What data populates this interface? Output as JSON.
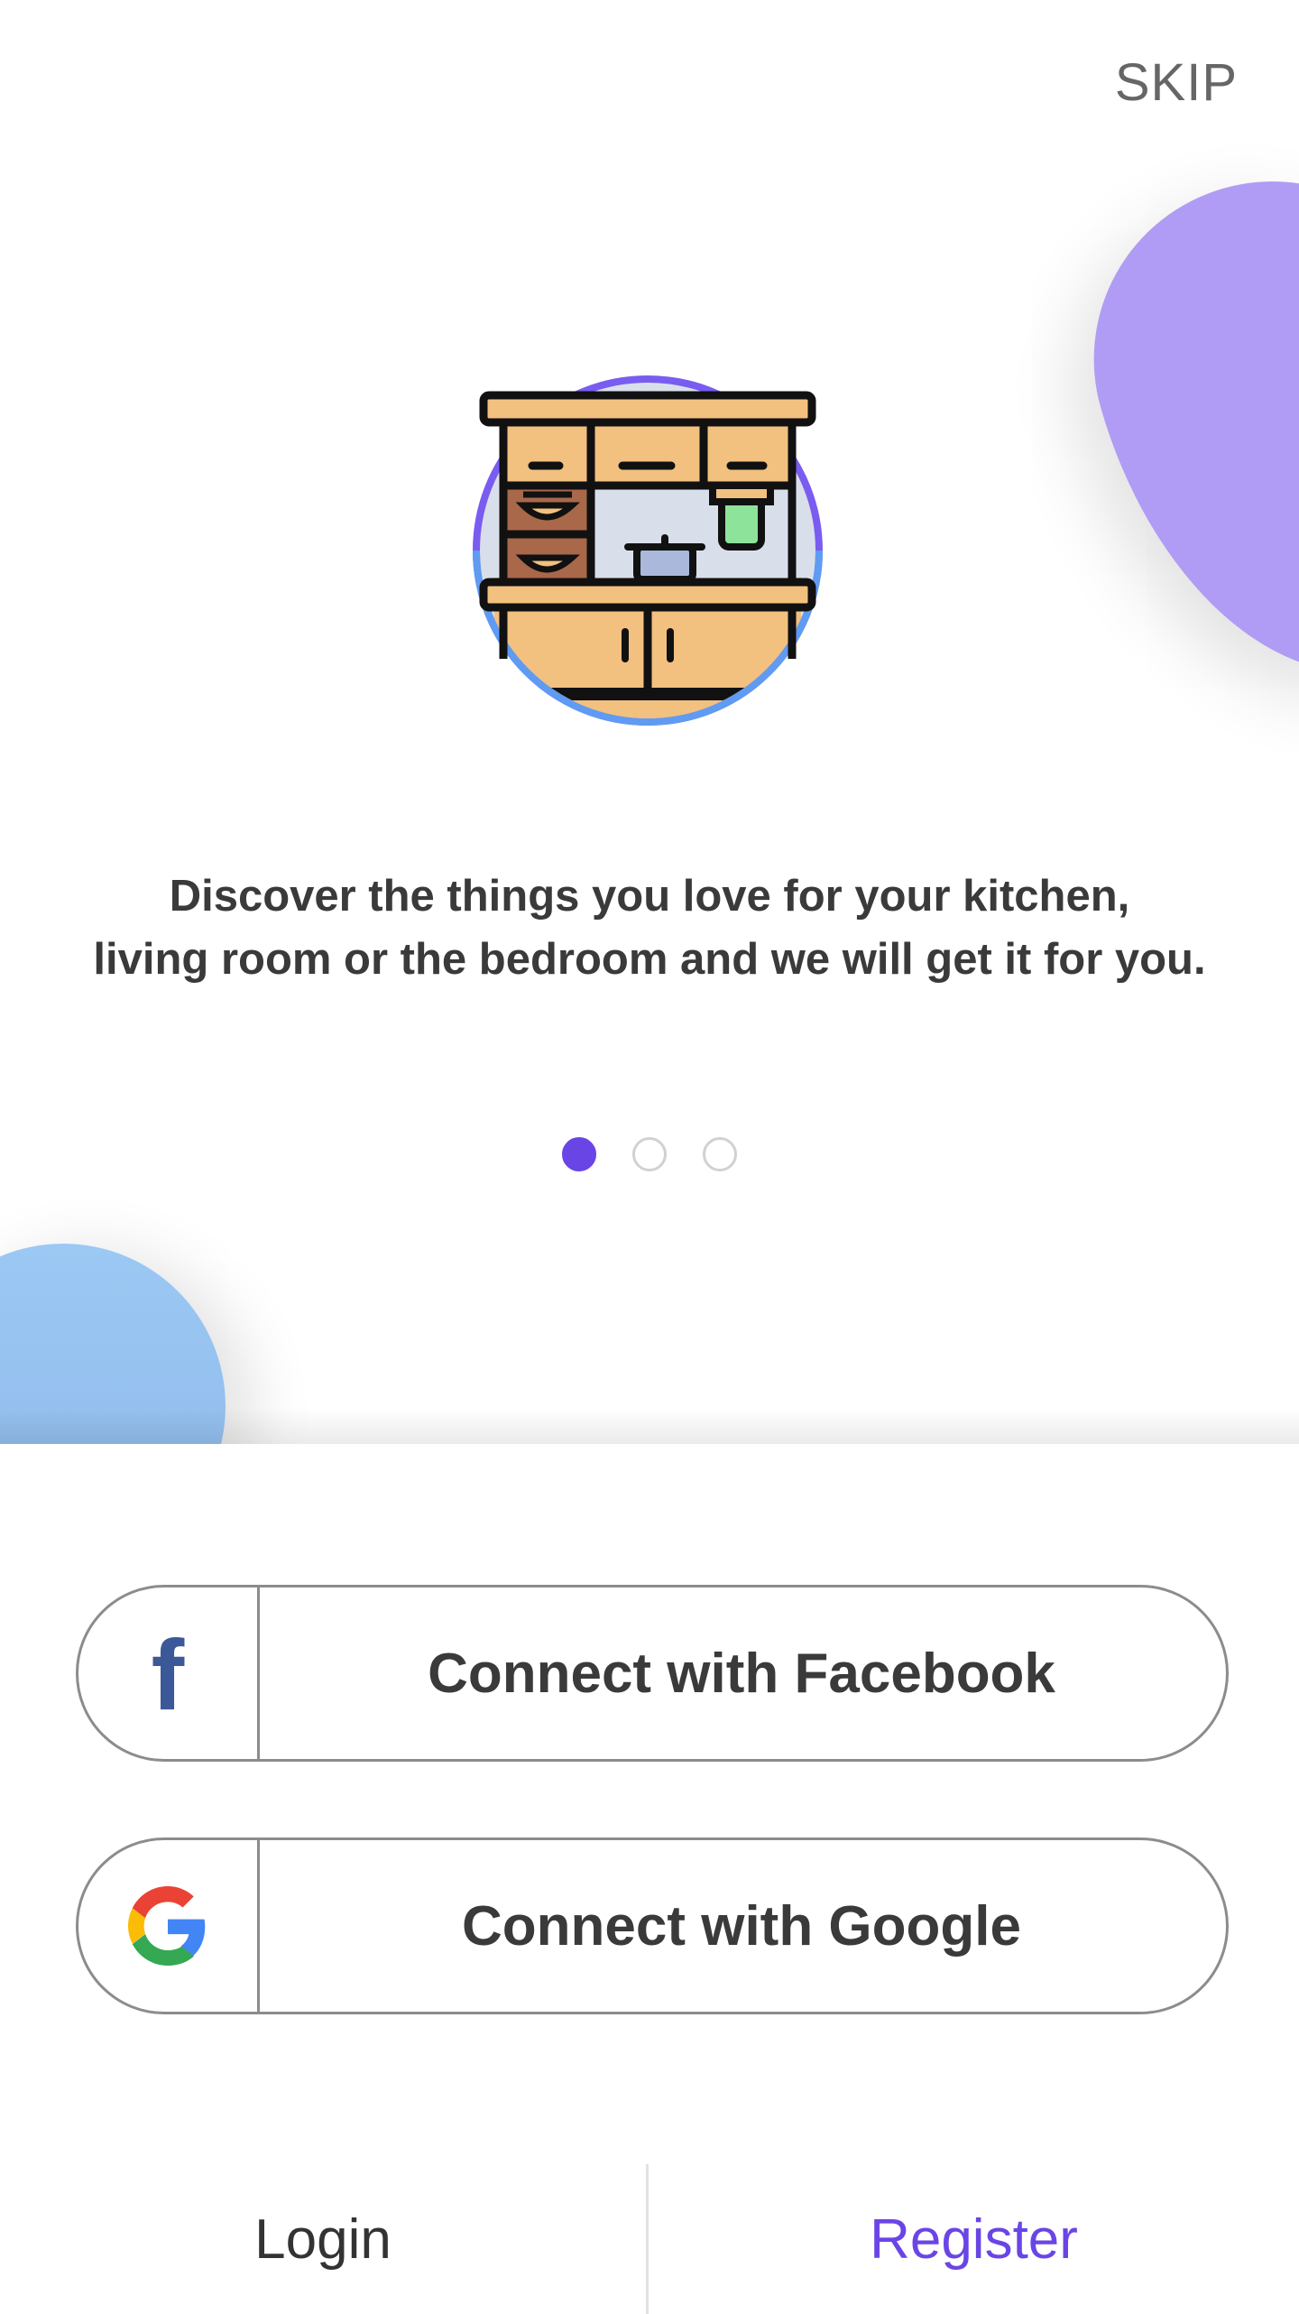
{
  "header": {
    "skip_label": "SKIP"
  },
  "onboarding": {
    "description_line1": "Discover the things you love for your kitchen,",
    "description_line2": "living room or the bedroom and we will get it for you.",
    "illustration": "kitchen-cabinet-illustration",
    "page_indicator": {
      "total": 3,
      "active": 1
    }
  },
  "auth": {
    "facebook_label": "Connect with Facebook",
    "google_label": "Connect with Google",
    "facebook_icon": "facebook-icon",
    "google_icon": "google-icon"
  },
  "bottom_bar": {
    "login_label": "Login",
    "register_label": "Register"
  },
  "colors": {
    "accent": "#6a45e6",
    "blob_purple": "#b09cf4",
    "blob_blue": "#9cc8f4",
    "facebook_blue": "#3b5998",
    "text": "#3a3a3a"
  }
}
